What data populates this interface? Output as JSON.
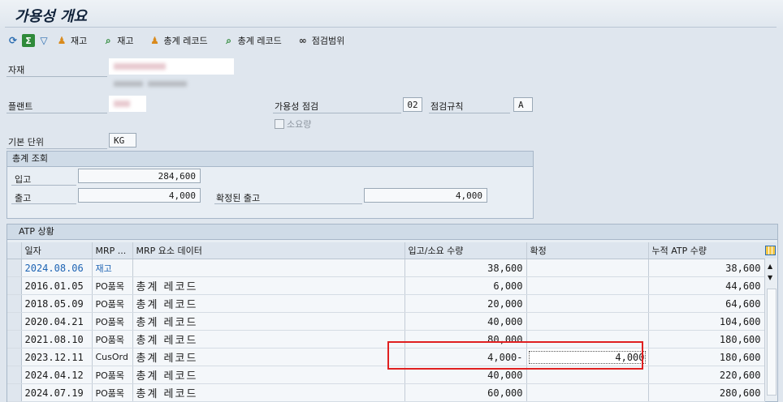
{
  "title": "가용성 개요",
  "toolbar": {
    "icons": [
      "refresh-icon",
      "sigma-icon",
      "filter-icon"
    ],
    "buttons": [
      {
        "label": "재고",
        "icon": "people-icon"
      },
      {
        "label": "재고",
        "icon": "magnifier-icon"
      },
      {
        "label": "총계 레코드",
        "icon": "people-icon"
      },
      {
        "label": "총계 레코드",
        "icon": "magnifier-icon"
      },
      {
        "label": "점검범위",
        "icon": "glasses-icon"
      }
    ]
  },
  "header": {
    "material_label": "자재",
    "plant_label": "플랜트",
    "availability_check_label": "가용성 점검",
    "availability_check_value": "02",
    "check_rule_label": "점검규칙",
    "check_rule_value": "A",
    "requirement_label": "소요량",
    "base_unit_label": "기본 단위",
    "base_unit_value": "KG"
  },
  "totals": {
    "title": "총계 조회",
    "receipts_label": "입고",
    "receipts_value": "284,600",
    "issues_label": "출고",
    "issues_value": "4,000",
    "confirmed_issues_label": "확정된 출고",
    "confirmed_issues_value": "4,000"
  },
  "atp": {
    "title": "ATP 상황",
    "columns": [
      "일자",
      "MRP ...",
      "MRP 요소 데이터",
      "입고/소요 수량",
      "확정",
      "누적 ATP 수량"
    ],
    "rows": [
      {
        "date": "2024.08.06",
        "mrp": "재고",
        "data": "",
        "qty": "38,600",
        "confirmed": "",
        "cum": "38,600"
      },
      {
        "date": "2016.01.05",
        "mrp": "PO품목",
        "data": "총계 레코드",
        "qty": "6,000",
        "confirmed": "",
        "cum": "44,600"
      },
      {
        "date": "2018.05.09",
        "mrp": "PO품목",
        "data": "총계 레코드",
        "qty": "20,000",
        "confirmed": "",
        "cum": "64,600"
      },
      {
        "date": "2020.04.21",
        "mrp": "PO품목",
        "data": "총계 레코드",
        "qty": "40,000",
        "confirmed": "",
        "cum": "104,600"
      },
      {
        "date": "2021.08.10",
        "mrp": "PO품목",
        "data": "총계 레코드",
        "qty": "80,000",
        "confirmed": "",
        "cum": "180,600"
      },
      {
        "date": "2023.12.11",
        "mrp": "CusOrd",
        "data": "총계 레코드",
        "qty": "4,000-",
        "confirmed": "4,000",
        "cum": "180,600"
      },
      {
        "date": "2024.04.12",
        "mrp": "PO품목",
        "data": "총계 레코드",
        "qty": "40,000",
        "confirmed": "",
        "cum": "220,600"
      },
      {
        "date": "2024.07.19",
        "mrp": "PO품목",
        "data": "총계 레코드",
        "qty": "60,000",
        "confirmed": "",
        "cum": "280,600"
      }
    ]
  },
  "colors": {
    "highlight": "#e02020",
    "link": "#1e64b4"
  }
}
